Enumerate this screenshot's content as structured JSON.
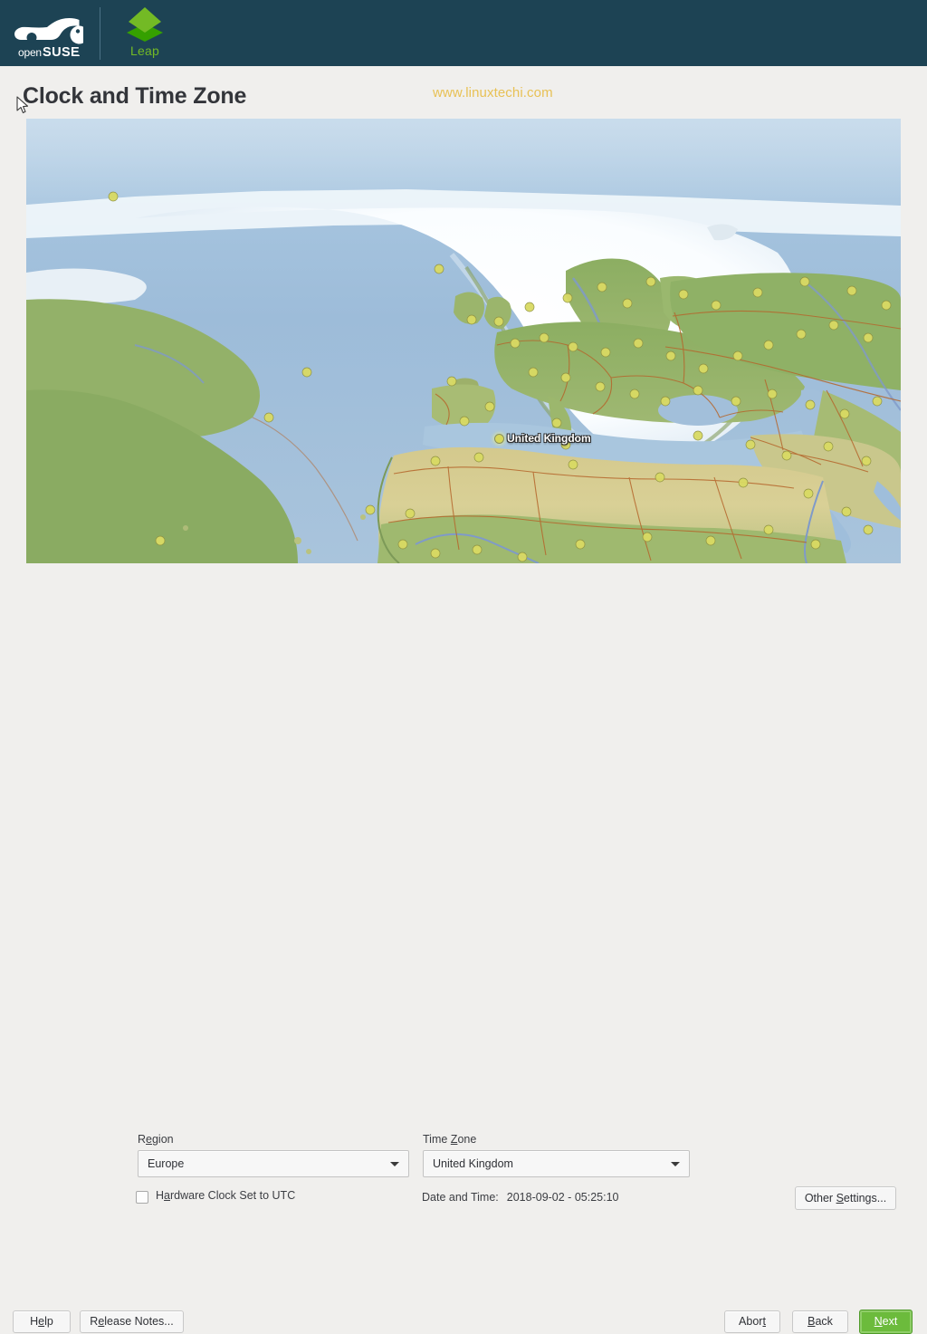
{
  "header": {
    "brand": "openSUSE",
    "product": "Leap",
    "bg_color": "#1d4354",
    "accent_green": "#73ba25"
  },
  "page": {
    "title": "Clock and Time Zone",
    "watermark": "www.linuxtechi.com",
    "watermark_color": "#e8c155"
  },
  "map": {
    "selected_label": "United Kingdom",
    "marker_color": "#d7d85a",
    "ocean_color": "#9fbddc",
    "land_color": "#8fae63",
    "desert_color": "#d9cf92",
    "ice_color": "#fbfdfe",
    "border_color": "#b5662c"
  },
  "form": {
    "region_label": "Region",
    "region_label_pre": "R",
    "region_label_mnemonic": "e",
    "region_label_post": "gion",
    "region_value": "Europe",
    "timezone_label_pre": "Time ",
    "timezone_label_mnemonic": "Z",
    "timezone_label_post": "one",
    "timezone_value": "United Kingdom",
    "hwclock_pre": "H",
    "hwclock_mnemonic": "a",
    "hwclock_post": "rdware Clock Set to UTC",
    "hwclock_checked": false,
    "datetime_label": "Date and Time:",
    "datetime_value": "2018-09-02 - 05:25:10",
    "other_settings_pre": "Other ",
    "other_settings_mnemonic": "S",
    "other_settings_post": "ettings..."
  },
  "buttons": {
    "help_pre": "H",
    "help_mnemonic": "e",
    "help_post": "lp",
    "release_notes_pre": "R",
    "release_notes_mnemonic": "e",
    "release_notes_post": "lease Notes...",
    "abort_pre": "Abor",
    "abort_mnemonic": "t",
    "abort_post": "",
    "back_pre": "",
    "back_mnemonic": "B",
    "back_post": "ack",
    "next_pre": "",
    "next_mnemonic": "N",
    "next_post": "ext",
    "next_color": "#6cbb3c"
  }
}
